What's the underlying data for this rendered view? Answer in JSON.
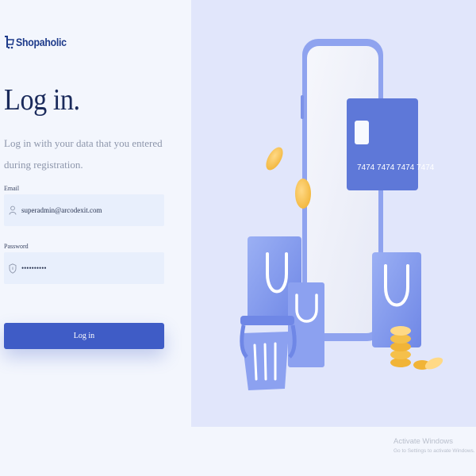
{
  "brand": {
    "name": "Shopaholic"
  },
  "login": {
    "title": "Log in.",
    "subtitle": "Log in with your data that you entered during registration.",
    "email_label": "Email",
    "email_value": "superadmin@arcodexit.com",
    "password_label": "Password",
    "password_value": "••••••••••",
    "submit_label": "Log in"
  },
  "illustration": {
    "card_number": "7474 7474 7474 7474"
  },
  "watermark": {
    "title": "Activate Windows",
    "subtitle": "Go to Settings to activate Windows."
  },
  "colors": {
    "accent": "#3f5cc6",
    "brand": "#1d3a8a",
    "input_bg": "#e8effc",
    "panel_bg": "#e1e6fb"
  },
  "icons": {
    "email": "user-icon",
    "password": "shield-icon"
  }
}
